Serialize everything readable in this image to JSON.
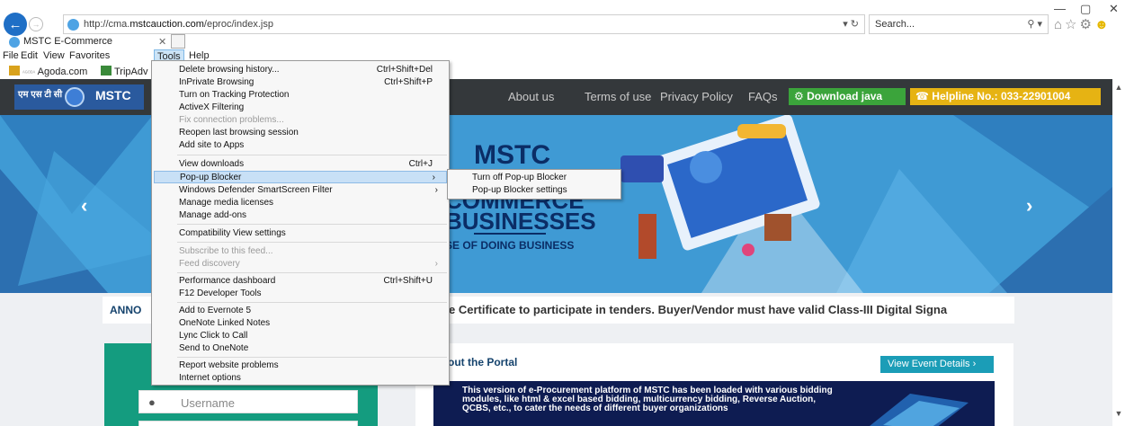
{
  "window": {
    "min": "—",
    "max": "▢",
    "close": "✕"
  },
  "browser": {
    "url_prefix": "http://cma.",
    "url_domain": "mstcauction.com",
    "url_path": "/eproc/index.jsp",
    "addr_tools": "▾ ↻",
    "search_placeholder": "Search...",
    "search_icon": "⚲ ▾",
    "right_icons": "⌂☆⚙",
    "smiley": "☻",
    "tab_title": "MSTC E-Commerce",
    "tab_close": "✕"
  },
  "menubar": [
    "File",
    "Edit",
    "View",
    "Favorites",
    "Tools",
    "Help"
  ],
  "favorites": [
    {
      "label": "Agoda.com",
      "prefix": "ᴬᴳᴼᴰᴬ"
    },
    {
      "label": "TripAdv"
    }
  ],
  "tools_menu": [
    {
      "label": "Delete browsing history...",
      "shortcut": "Ctrl+Shift+Del"
    },
    {
      "label": "InPrivate Browsing",
      "shortcut": "Ctrl+Shift+P"
    },
    {
      "label": "Turn on Tracking Protection"
    },
    {
      "label": "ActiveX Filtering"
    },
    {
      "label": "Fix connection problems...",
      "disabled": true
    },
    {
      "label": "Reopen last browsing session"
    },
    {
      "label": "Add site to Apps"
    },
    {
      "label": "View downloads",
      "shortcut": "Ctrl+J"
    },
    {
      "label": "Pop-up Blocker",
      "submenu": true
    },
    {
      "label": "Windows Defender SmartScreen Filter",
      "submenu": true
    },
    {
      "label": "Manage media licenses"
    },
    {
      "label": "Manage add-ons"
    },
    {
      "label": "Compatibility View settings"
    },
    {
      "label": "Subscribe to this feed...",
      "disabled": true
    },
    {
      "label": "Feed discovery",
      "disabled": true,
      "submenu": true
    },
    {
      "label": "Performance dashboard",
      "shortcut": "Ctrl+Shift+U"
    },
    {
      "label": "F12 Developer Tools"
    },
    {
      "label": "Add to Evernote 5"
    },
    {
      "label": "OneNote Linked Notes"
    },
    {
      "label": "Lync Click to Call"
    },
    {
      "label": "Send to OneNote"
    },
    {
      "label": "Report website problems"
    },
    {
      "label": "Internet options"
    }
  ],
  "popup_submenu": [
    "Turn off Pop-up Blocker",
    "Pop-up Blocker settings"
  ],
  "site": {
    "logo_hindi": "एम एस टी सी",
    "logo_text": "MSTC",
    "nav": [
      "About us",
      "Terms of use",
      "Privacy Policy",
      "FAQs"
    ],
    "download_java": "⚙ Download java",
    "helpline": "☎ Helpline No.: 033-22901004",
    "banner_title": "MSTC",
    "banner_line2": "COMMERCE",
    "banner_line3": "BUSINESSES",
    "banner_tag": "SE OF DOING BUSINESS",
    "arrow_left": "‹",
    "arrow_right": "›",
    "announce_label": "ANNO",
    "announce_text": "e Certificate to participate in tenders.  Buyer/Vendor must have valid Class-III Digital Signa",
    "username_icon": "●",
    "username_placeholder": "Username",
    "portal_title": "out the Portal",
    "event_button": "View Event Details  ›",
    "portal_text": "This version of e-Procurement platform of MSTC has been loaded with various bidding modules, like html & excel based bidding, multicurrency bidding, Reverse Auction, QCBS, etc., to cater the needs of different buyer organizations"
  },
  "scrollbar": {
    "up": "▲",
    "down": "▼"
  },
  "colors": {
    "accent": "#1f6fc6",
    "header": "#34383b",
    "java": "#3ba43b",
    "helpline": "#e6b313",
    "banner": "#3f9ad4",
    "login": "#149c7f",
    "event": "#1b9db7"
  }
}
